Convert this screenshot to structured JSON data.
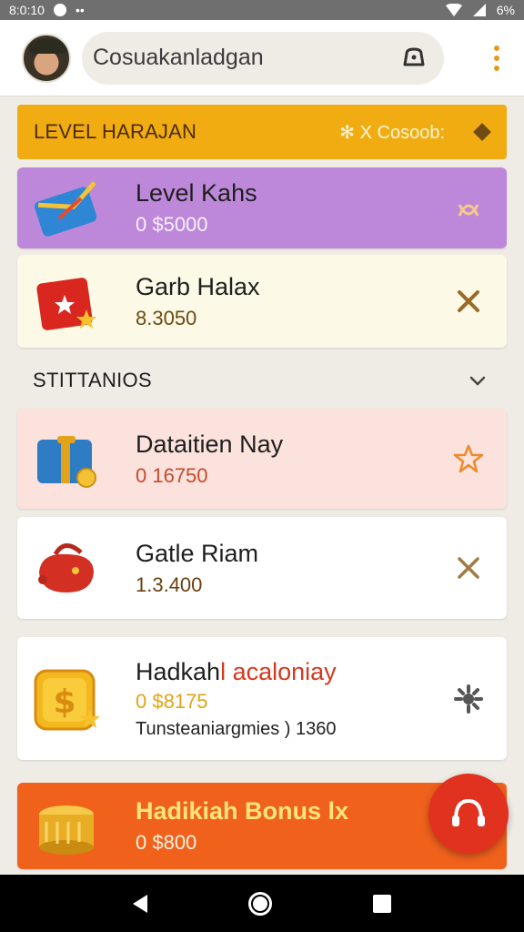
{
  "status_bar": {
    "time": "8:0:10",
    "dots": "••",
    "battery": "6%"
  },
  "app_bar": {
    "search_text": "Cosuakanladgan"
  },
  "level_header": {
    "title": "LEVEL HARAJAN",
    "right_text": "✻ X Cosoob:"
  },
  "cards": [
    {
      "title": "Level Kahs",
      "subtitle": "0 $5000",
      "thumb": "blue-envelope",
      "action": "ribbon-icon"
    },
    {
      "title": "Garb Halax",
      "subtitle": "8.3050",
      "thumb": "red-gift-box",
      "action": "close-icon"
    },
    {
      "title": "Dataitien Nay",
      "subtitle": "0 16750",
      "thumb": "blue-treasure-chest",
      "action": "star-icon"
    },
    {
      "title": "Gatle Riam",
      "subtitle": "1.3.400",
      "thumb": "red-bag",
      "action": "close-icon"
    },
    {
      "title_a": "Hadkah",
      "title_b": "l acaloniay",
      "subtitle": "0 $8175",
      "extra": "Tunsteaniargmies ) 1360",
      "thumb": "gold-dollar-coin",
      "action": "settings-icon"
    },
    {
      "title": "Hadikiah Bonus lx",
      "subtitle": "0 $800",
      "thumb": "gold-chest"
    }
  ],
  "section": {
    "title": "STITTANIOS"
  },
  "colors": {
    "accent": "#f1ac12",
    "fab": "#e0321f",
    "purple": "#bd88d9",
    "orange": "#f0611c"
  }
}
